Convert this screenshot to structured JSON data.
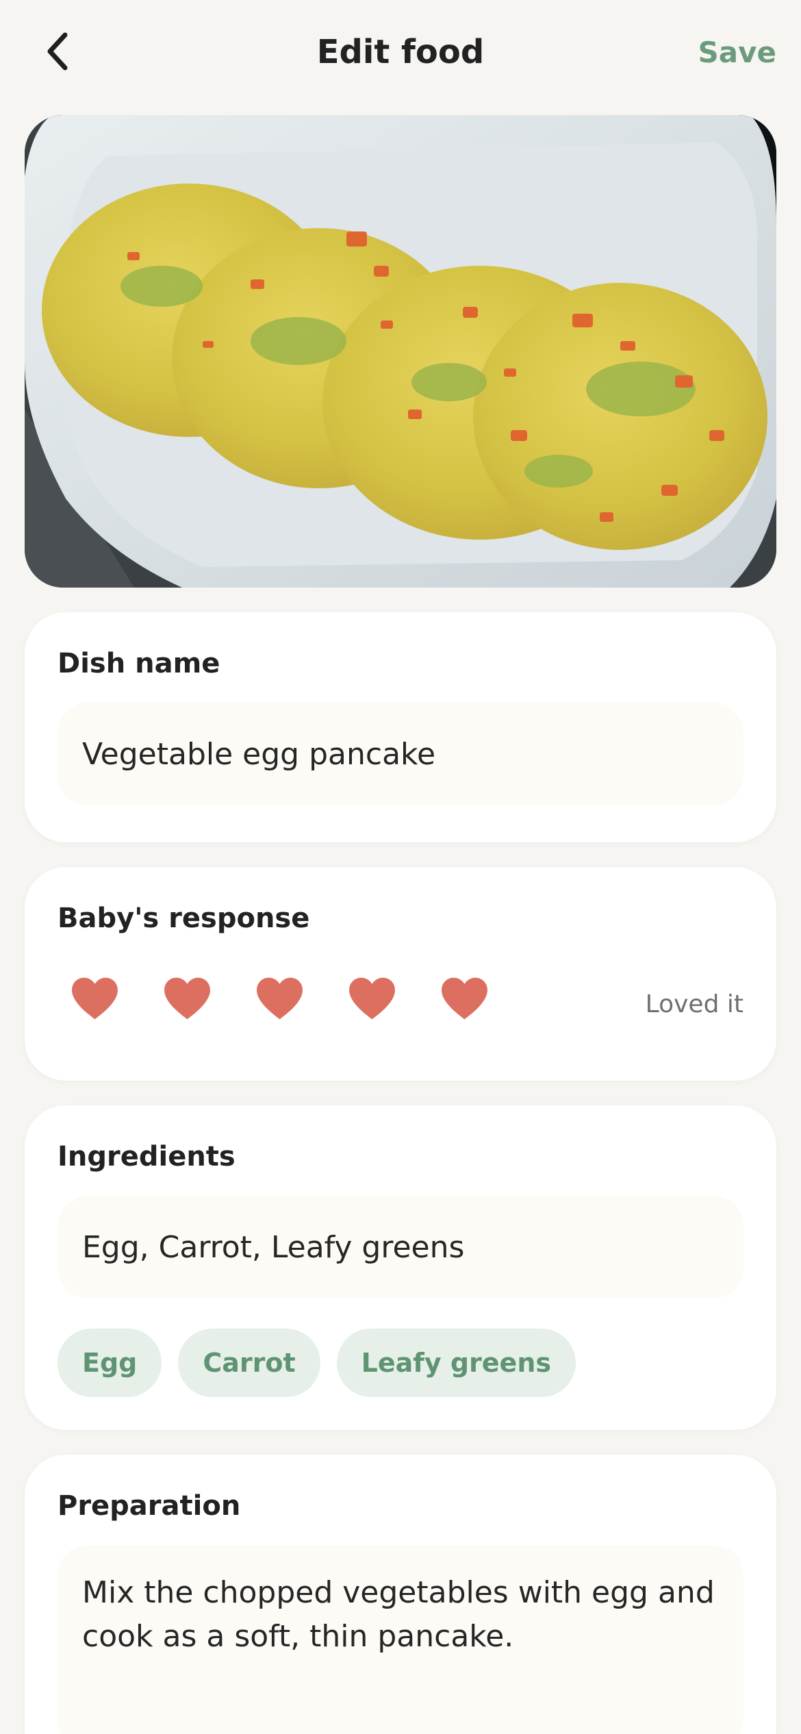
{
  "header": {
    "title": "Edit food",
    "save_label": "Save",
    "back_icon": "chevron-left-icon"
  },
  "photo": {
    "subject": "vegetable egg pancakes on a white plate"
  },
  "dish": {
    "label": "Dish name",
    "value": "Vegetable egg pancake"
  },
  "response": {
    "label": "Baby's response",
    "rating": 5,
    "max_rating": 5,
    "rating_text": "Loved it",
    "heart_color": "#dd6f61"
  },
  "ingredients": {
    "label": "Ingredients",
    "value": "Egg, Carrot, Leafy greens",
    "chips": [
      "Egg",
      "Carrot",
      "Leafy greens"
    ]
  },
  "preparation": {
    "label": "Preparation",
    "value": "Mix the chopped vegetables with egg and cook as a soft, thin pancake."
  },
  "colors": {
    "accent": "#6a9c7c",
    "chip_bg": "#e6efe8",
    "background": "#f7f5f2"
  }
}
